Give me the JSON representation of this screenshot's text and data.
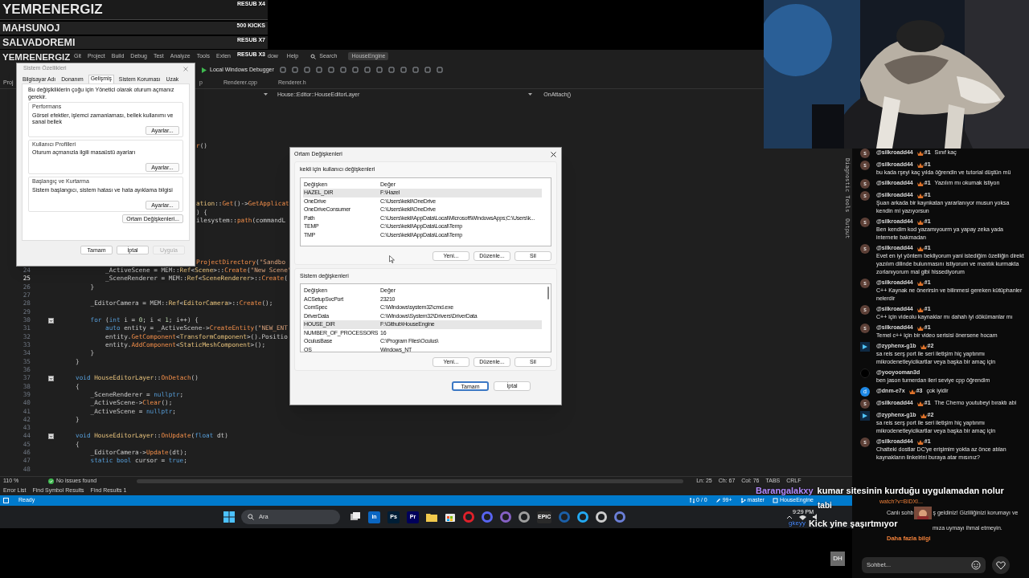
{
  "leaderboard": [
    {
      "kind": "top",
      "name": "YEMRENERGIZ",
      "note": "RESUB X4"
    },
    {
      "kind": "banner",
      "name": "MAHSUNOJ",
      "note": "500 KICKS"
    },
    {
      "kind": "banner",
      "name": "SALVADOREMI",
      "note": "RESUB X7"
    },
    {
      "kind": "plain",
      "name": "YEMRENERGIZ",
      "note": "RESUB X3"
    }
  ],
  "ide": {
    "menu": [
      "Git",
      "Project",
      "Build",
      "Debug",
      "Test",
      "Analyze",
      "Tools",
      "Exten"
    ],
    "menu_after": [
      "dow",
      "Help"
    ],
    "search": "Search",
    "solution": "HouseEngine",
    "debugger": "Local Windows Debugger",
    "side_tab": "Proj",
    "tabs": [
      {
        "label": "p",
        "selected": false
      },
      {
        "label": "Renderer.cpp",
        "selected": false
      },
      {
        "label": "Renderer.h",
        "selected": false
      }
    ],
    "breadcrumb": "House::Editor::HouseEditorLayer",
    "member": "OnAttach()",
    "lines": [
      {
        "kind": "clipped",
        "tokens": [
          {
            "kind": "fn",
            "text": "r"
          },
          {
            "kind": "var",
            "text": "()"
          }
        ]
      },
      {
        "kind": "blank"
      },
      {
        "kind": "blank"
      },
      {
        "kind": "blank"
      },
      {
        "kind": "blank"
      },
      {
        "kind": "blank"
      },
      {
        "kind": "blank"
      },
      {
        "kind": "clipped",
        "tokens": [
          {
            "kind": "cls",
            "text": "ation"
          },
          {
            "kind": "var",
            "text": "::"
          },
          {
            "kind": "fn",
            "text": "Get"
          },
          {
            "kind": "var",
            "text": "()->"
          },
          {
            "kind": "fn",
            "text": "GetApplicat"
          }
        ]
      },
      {
        "kind": "clipped",
        "tokens": [
          {
            "kind": "var",
            "text": ") {"
          }
        ]
      },
      {
        "kind": "clipped",
        "tokens": [
          {
            "kind": "var",
            "text": "ilesystem::"
          },
          {
            "kind": "fn",
            "text": "path"
          },
          {
            "kind": "var",
            "text": "(commandL"
          }
        ]
      },
      {
        "kind": "blank"
      },
      {
        "kind": "blank"
      },
      {
        "kind": "blank"
      },
      {
        "kind": "blank"
      },
      {
        "kind": "clipped",
        "tokens": [
          {
            "kind": "fn",
            "text": "ProjectDirectory"
          },
          {
            "kind": "var",
            "text": "("
          },
          {
            "kind": "str",
            "text": "\"Sandbo"
          }
        ]
      },
      {
        "kind": "code",
        "number": "24",
        "current": false,
        "fold": false,
        "tokens": [
          {
            "kind": "var",
            "text": "        _ActiveScene = MEM::"
          },
          {
            "kind": "cls",
            "text": "Ref"
          },
          {
            "kind": "var",
            "text": "<"
          },
          {
            "kind": "cls",
            "text": "Scene"
          },
          {
            "kind": "var",
            "text": ">::"
          },
          {
            "kind": "fn",
            "text": "Create"
          },
          {
            "kind": "var",
            "text": "("
          },
          {
            "kind": "str",
            "text": "\"New Scene\""
          }
        ]
      },
      {
        "kind": "code",
        "number": "25",
        "current": true,
        "fold": false,
        "tokens": [
          {
            "kind": "var",
            "text": "        _SceneRenderer = MEM::"
          },
          {
            "kind": "cls",
            "text": "Ref"
          },
          {
            "kind": "var",
            "text": "<"
          },
          {
            "kind": "cls",
            "text": "SceneRenderer"
          },
          {
            "kind": "var",
            "text": ">::"
          },
          {
            "kind": "fn",
            "text": "Create"
          },
          {
            "kind": "var",
            "text": "("
          }
        ]
      },
      {
        "kind": "code",
        "number": "26",
        "current": false,
        "fold": false,
        "tokens": [
          {
            "kind": "var",
            "text": "    }"
          }
        ]
      },
      {
        "kind": "code",
        "number": "27",
        "current": false,
        "fold": false
      },
      {
        "kind": "code",
        "number": "28",
        "current": false,
        "fold": false,
        "tokens": [
          {
            "kind": "var",
            "text": "    _EditorCamera = MEM::"
          },
          {
            "kind": "cls",
            "text": "Ref"
          },
          {
            "kind": "var",
            "text": "<"
          },
          {
            "kind": "cls",
            "text": "EditorCamera"
          },
          {
            "kind": "var",
            "text": ">::"
          },
          {
            "kind": "fn",
            "text": "Create"
          },
          {
            "kind": "var",
            "text": "();"
          }
        ]
      },
      {
        "kind": "code",
        "number": "29",
        "current": false,
        "fold": false
      },
      {
        "kind": "code",
        "number": "30",
        "current": false,
        "fold": true,
        "tokens": [
          {
            "kind": "kw",
            "text": "    for"
          },
          {
            "kind": "var",
            "text": " ("
          },
          {
            "kind": "kw",
            "text": "int"
          },
          {
            "kind": "var",
            "text": " i = "
          },
          {
            "kind": "num",
            "text": "0"
          },
          {
            "kind": "var",
            "text": "; i < "
          },
          {
            "kind": "num",
            "text": "1"
          },
          {
            "kind": "var",
            "text": "; i++) {"
          }
        ]
      },
      {
        "kind": "code",
        "number": "31",
        "current": false,
        "fold": false,
        "tokens": [
          {
            "kind": "kw",
            "text": "        auto"
          },
          {
            "kind": "var",
            "text": " entity = _ActiveScene->"
          },
          {
            "kind": "fn",
            "text": "CreateEntity"
          },
          {
            "kind": "var",
            "text": "("
          },
          {
            "kind": "str",
            "text": "\"NEW_ENT"
          }
        ]
      },
      {
        "kind": "code",
        "number": "32",
        "current": false,
        "fold": false,
        "tokens": [
          {
            "kind": "var",
            "text": "        entity."
          },
          {
            "kind": "fn",
            "text": "GetComponent"
          },
          {
            "kind": "var",
            "text": "<"
          },
          {
            "kind": "cls",
            "text": "TransformComponent"
          },
          {
            "kind": "var",
            "text": ">().Positio"
          }
        ]
      },
      {
        "kind": "code",
        "number": "33",
        "current": false,
        "fold": false,
        "tokens": [
          {
            "kind": "var",
            "text": "        entity."
          },
          {
            "kind": "fn",
            "text": "AddComponent"
          },
          {
            "kind": "var",
            "text": "<"
          },
          {
            "kind": "cls",
            "text": "StaticMeshComponent"
          },
          {
            "kind": "var",
            "text": ">();"
          }
        ]
      },
      {
        "kind": "code",
        "number": "34",
        "current": false,
        "fold": false,
        "tokens": [
          {
            "kind": "var",
            "text": "    }"
          }
        ]
      },
      {
        "kind": "code",
        "number": "35",
        "current": false,
        "fold": false,
        "tokens": [
          {
            "kind": "var",
            "text": "}"
          }
        ]
      },
      {
        "kind": "code",
        "number": "36",
        "current": false,
        "fold": false
      },
      {
        "kind": "code",
        "number": "37",
        "current": false,
        "fold": true,
        "tokens": [
          {
            "kind": "kw",
            "text": "void "
          },
          {
            "kind": "cls",
            "text": "HouseEditorLayer"
          },
          {
            "kind": "var",
            "text": "::"
          },
          {
            "kind": "fn",
            "text": "OnDetach"
          },
          {
            "kind": "var",
            "text": "()"
          }
        ]
      },
      {
        "kind": "code",
        "number": "38",
        "current": false,
        "fold": false,
        "tokens": [
          {
            "kind": "var",
            "text": "{"
          }
        ]
      },
      {
        "kind": "code",
        "number": "39",
        "current": false,
        "fold": false,
        "tokens": [
          {
            "kind": "var",
            "text": "    _SceneRenderer = "
          },
          {
            "kind": "kw",
            "text": "nullptr"
          },
          {
            "kind": "var",
            "text": ";"
          }
        ]
      },
      {
        "kind": "code",
        "number": "40",
        "current": false,
        "fold": false,
        "tokens": [
          {
            "kind": "var",
            "text": "    _ActiveScene->"
          },
          {
            "kind": "fn",
            "text": "Clear"
          },
          {
            "kind": "var",
            "text": "();"
          }
        ]
      },
      {
        "kind": "code",
        "number": "41",
        "current": false,
        "fold": false,
        "tokens": [
          {
            "kind": "var",
            "text": "    _ActiveScene = "
          },
          {
            "kind": "kw",
            "text": "nullptr"
          },
          {
            "kind": "var",
            "text": ";"
          }
        ]
      },
      {
        "kind": "code",
        "number": "42",
        "current": false,
        "fold": false,
        "tokens": [
          {
            "kind": "var",
            "text": "}"
          }
        ]
      },
      {
        "kind": "code",
        "number": "43",
        "current": false,
        "fold": false
      },
      {
        "kind": "code",
        "number": "44",
        "current": false,
        "fold": true,
        "tokens": [
          {
            "kind": "kw",
            "text": "void "
          },
          {
            "kind": "cls",
            "text": "HouseEditorLayer"
          },
          {
            "kind": "var",
            "text": "::"
          },
          {
            "kind": "fn",
            "text": "OnUpdate"
          },
          {
            "kind": "var",
            "text": "("
          },
          {
            "kind": "kw",
            "text": "float"
          },
          {
            "kind": "var",
            "text": " dt)"
          }
        ]
      },
      {
        "kind": "code",
        "number": "45",
        "current": false,
        "fold": false,
        "tokens": [
          {
            "kind": "var",
            "text": "{"
          }
        ]
      },
      {
        "kind": "code",
        "number": "46",
        "current": false,
        "fold": false,
        "tokens": [
          {
            "kind": "var",
            "text": "    _EditorCamera->"
          },
          {
            "kind": "fn",
            "text": "Update"
          },
          {
            "kind": "var",
            "text": "(dt);"
          }
        ]
      },
      {
        "kind": "code",
        "number": "47",
        "current": false,
        "fold": false,
        "tokens": [
          {
            "kind": "kw",
            "text": "    static bool"
          },
          {
            "kind": "var",
            "text": " cursor = "
          },
          {
            "kind": "kw",
            "text": "true"
          },
          {
            "kind": "var",
            "text": ";"
          }
        ]
      },
      {
        "kind": "code",
        "number": "48",
        "current": false,
        "fold": false
      }
    ],
    "zoom": "110 %",
    "issues": "No issues found",
    "position": [
      "Ln: 25",
      "Ch: 67",
      "Col: 76",
      "TABS",
      "CRLF"
    ],
    "panel_tabs": [
      "Error List",
      "Find Symbol Results",
      "Find Results 1"
    ],
    "side_panels": [
      "Diagnostic Tools",
      "Output"
    ],
    "status": {
      "state": "Ready",
      "changes": "0 / 0",
      "edits": "99+",
      "branch": "master",
      "repo": "HouseEngine"
    }
  },
  "taskbar": {
    "search": "Ara",
    "apps": [
      {
        "kind": "taskview"
      },
      {
        "kind": "label",
        "label": "in",
        "color": "#0a66c2"
      },
      {
        "kind": "label",
        "label": "Ps",
        "color": "#001e36"
      },
      {
        "kind": "label",
        "label": "Pr",
        "color": "#00005b"
      },
      {
        "kind": "folder"
      },
      {
        "kind": "store"
      },
      {
        "kind": "ring",
        "color": "#e0202a"
      },
      {
        "kind": "ring",
        "color": "#5865f2"
      },
      {
        "kind": "ring",
        "color": "#8661c5"
      },
      {
        "kind": "ring",
        "color": "#9e9e9e"
      },
      {
        "kind": "label",
        "label": "EPIC",
        "color": "#2a2a2a"
      },
      {
        "kind": "ring",
        "color": "#1b5fa8"
      },
      {
        "kind": "ring",
        "color": "#23a9f2"
      },
      {
        "kind": "ring",
        "color": "#cccccc"
      },
      {
        "kind": "ring",
        "color": "#6b7fd7"
      }
    ],
    "clock": "9:29 PM"
  },
  "chat": {
    "messages": [
      {
        "avatar": {
          "kind": "letter",
          "letter": "s",
          "color": "#5d4037"
        },
        "user": "@silkroadd44",
        "rank": "#1",
        "text": "Sınıf kaç"
      },
      {
        "avatar": {
          "kind": "letter",
          "letter": "s",
          "color": "#5d4037"
        },
        "user": "@silkroadd44",
        "rank": "#1",
        "text": "bu kada rşeyi kaç yılda öğrendin ve tutorial düştün mü"
      },
      {
        "avatar": {
          "kind": "letter",
          "letter": "s",
          "color": "#5d4037"
        },
        "user": "@silkroadd44",
        "rank": "#1",
        "text": "Yazılım mı okumak istiyon"
      },
      {
        "avatar": {
          "kind": "letter",
          "letter": "s",
          "color": "#5d4037"
        },
        "user": "@silkroadd44",
        "rank": "#1",
        "text": "Şuan arkada bir kaynkatan yararlanıyor musun yoksa kendin mi yazıyorsun"
      },
      {
        "avatar": {
          "kind": "letter",
          "letter": "s",
          "color": "#5d4037"
        },
        "user": "@silkroadd44",
        "rank": "#1",
        "text": "Ben kendim kod yazamıyourm ya yapay zeka yada internete bakmadan"
      },
      {
        "avatar": {
          "kind": "letter",
          "letter": "s",
          "color": "#5d4037"
        },
        "user": "@silkroadd44",
        "rank": "#1",
        "text": "Evet en iyi yöntem bekliyorum yani istediğim özelliğin direkt yazılım dilinde bulunmasını istiyorum ve mantık kurmakta zorlanıyorum mal gibi hissediyorum"
      },
      {
        "avatar": {
          "kind": "letter",
          "letter": "s",
          "color": "#5d4037"
        },
        "user": "@silkroadd44",
        "rank": "#1",
        "text": "C++ Kaynak ne önerirsin ve bilinmesi gereken kütüphanler nelerdir"
      },
      {
        "avatar": {
          "kind": "letter",
          "letter": "s",
          "color": "#5d4037"
        },
        "user": "@silkroadd44",
        "rank": "#1",
        "text": "C++ için videolu kaynaklar mı dahah iyi dökümanlar mı"
      },
      {
        "avatar": {
          "kind": "letter",
          "letter": "s",
          "color": "#5d4037"
        },
        "user": "@silkroadd44",
        "rank": "#1",
        "text": "Temel c++ için bir video serisisi önersene hocam"
      },
      {
        "avatar": {
          "kind": "logo"
        },
        "user": "@zyphenx-g1b",
        "rank": "#2",
        "text": "sa reis serş port ile seri iletişim hiç yaptınmı mikrodenetleyicikartlar veya başka bir amaç için"
      },
      {
        "avatar": {
          "kind": "blank"
        },
        "user": "@yooyooman3d",
        "text": "ben jason turnerdan ileri seviye cpp öğrendim"
      },
      {
        "avatar": {
          "kind": "letter",
          "letter": "d",
          "color": "#1e88e5"
        },
        "user": "@dnm-e7x",
        "rank": "#3",
        "text": "çok iyidir"
      },
      {
        "avatar": {
          "kind": "letter",
          "letter": "s",
          "color": "#5d4037"
        },
        "user": "@silkroadd44",
        "rank": "#1",
        "text": "The Cherno youtubeyi bıraktı abi"
      },
      {
        "avatar": {
          "kind": "logo"
        },
        "user": "@zyphenx-g1b",
        "rank": "#2",
        "text": "sa reis serş port ile seri iletişim hiç yaptınmı mikrodenetleyicikartlar veya başka bir amaç için"
      },
      {
        "avatar": {
          "kind": "letter",
          "letter": "s",
          "color": "#5d4037"
        },
        "user": "@silkroadd44",
        "rank": "#1",
        "text": "Chatteki dostlar DC'ye erişimim yokta az önce atılan kaynakların linkelrini buraya atar mısınız?"
      }
    ],
    "link_tail": "watch?v=BIDXI...",
    "notice_start": "Canlı sohb",
    "notice_rest": "ş geldiniz! Gizliliğinizi korumayı ve",
    "notice_end": "mıza uymayı ihmal etmeyin.",
    "more": "Daha fazla bilgi",
    "placeholder": "Sohbet..."
  },
  "overlay": {
    "user": "Barangalakxy",
    "message": "kumar sitesinin kurduğu uygulamadan nolur",
    "reply": "tabi",
    "user2": "gkeyy",
    "message2": "Kick yine şaşırtmıyor",
    "logo": "DH"
  },
  "system_properties": {
    "title": "Sistem Özellikleri",
    "tabs": [
      {
        "label": "Bilgisayar Adı",
        "selected": false
      },
      {
        "label": "Donanım",
        "selected": false
      },
      {
        "label": "Gelişmiş",
        "selected": true
      },
      {
        "label": "Sistem Koruması",
        "selected": false
      },
      {
        "label": "Uzak",
        "selected": false
      }
    ],
    "notice": "Bu değişikliklerin çoğu için Yönetici olarak oturum açmanız gerekir.",
    "groups": [
      {
        "title": "Performans",
        "text": "Görsel efektler, işlemci zamanlaması, bellek kullanımı ve sanal bellek",
        "button": "Ayarlar..."
      },
      {
        "title": "Kullanıcı Profilleri",
        "text": "Oturum açmanızla ilgili masaüstü ayarları",
        "button": "Ayarlar..."
      },
      {
        "title": "Başlangıç ve Kurtarma",
        "text": "Sistem başlangıcı, sistem hatası ve hata ayıklama bilgisi",
        "button": "Ayarlar..."
      }
    ],
    "env_button": "Ortam Değişkenleri...",
    "buttons": [
      {
        "label": "Tamam",
        "disabled": false
      },
      {
        "label": "İptal",
        "disabled": false
      },
      {
        "label": "Uygula",
        "disabled": true
      }
    ]
  },
  "environment": {
    "title": "Ortam Değişkenleri",
    "sections": [
      {
        "title": "kekli için kullanıcı değişkenleri",
        "columns": [
          "Değişken",
          "Değer"
        ],
        "scrollbar": false,
        "rows": [
          {
            "name": "HAZEL_DIR",
            "value": "F:\\Hazel",
            "selected": true
          },
          {
            "name": "OneDrive",
            "value": "C:\\Users\\kekli\\OneDrive",
            "selected": false
          },
          {
            "name": "OneDriveConsumer",
            "value": "C:\\Users\\kekli\\OneDrive",
            "selected": false
          },
          {
            "name": "Path",
            "value": "C:\\Users\\kekli\\AppData\\Local\\Microsoft\\WindowsApps;C:\\Users\\k...",
            "selected": false
          },
          {
            "name": "TEMP",
            "value": "C:\\Users\\kekli\\AppData\\Local\\Temp",
            "selected": false
          },
          {
            "name": "TMP",
            "value": "C:\\Users\\kekli\\AppData\\Local\\Temp",
            "selected": false
          }
        ],
        "buttons": [
          "Yeni...",
          "Düzenle...",
          "Sil"
        ]
      },
      {
        "title": "Sistem değişkenleri",
        "columns": [
          "Değişken",
          "Değer"
        ],
        "scrollbar": true,
        "rows": [
          {
            "name": "ACSetupSvcPort",
            "value": "23210",
            "selected": false
          },
          {
            "name": "ComSpec",
            "value": "C:\\Windows\\system32\\cmd.exe",
            "selected": false
          },
          {
            "name": "DriverData",
            "value": "C:\\Windows\\System32\\Drivers\\DriverData",
            "selected": false
          },
          {
            "name": "HOUSE_DIR",
            "value": "F:\\Github\\HouseEngine",
            "selected": true
          },
          {
            "name": "NUMBER_OF_PROCESSORS",
            "value": "16",
            "selected": false
          },
          {
            "name": "OculusBase",
            "value": "C:\\Program Files\\Oculus\\",
            "selected": false
          },
          {
            "name": "OS",
            "value": "Windows_NT",
            "selected": false
          }
        ],
        "buttons": [
          "Yeni...",
          "Düzenle...",
          "Sil"
        ]
      }
    ],
    "buttons": [
      {
        "label": "Tamam",
        "default": true
      },
      {
        "label": "İptal",
        "default": false
      }
    ]
  }
}
